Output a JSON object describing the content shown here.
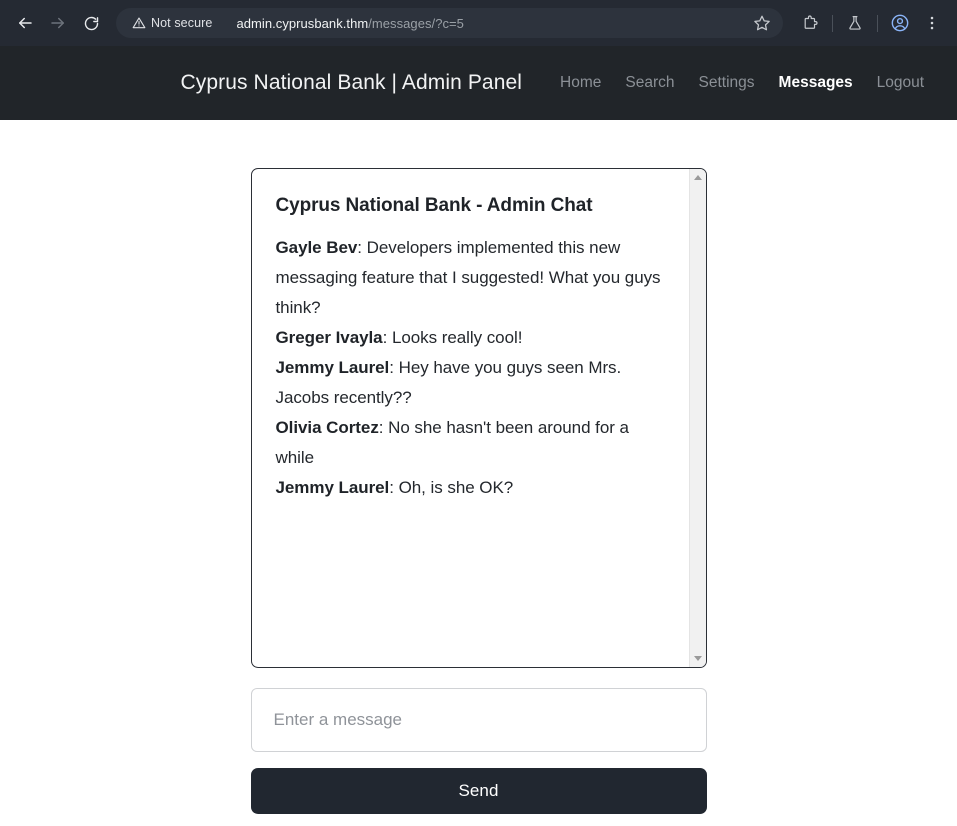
{
  "browser": {
    "back_icon": "arrow-left-icon",
    "forward_icon": "arrow-right-icon",
    "reload_icon": "reload-icon",
    "security_label": "Not secure",
    "security_icon": "warning-triangle-icon",
    "url_domain": "admin.cyprusbank.thm",
    "url_path": "/messages/?c=5",
    "bookmark_icon": "star-icon",
    "extensions_icon": "puzzle-piece-icon",
    "labs_icon": "flask-icon",
    "profile_icon": "account-circle-icon",
    "menu_icon": "three-dot-menu-icon",
    "colors": {
      "chrome_bg": "#252a33",
      "omnibox_bg": "#2d333d",
      "profile_accent": "#8ab4f8"
    }
  },
  "header": {
    "brand": "Cyprus National Bank | Admin Panel",
    "nav": [
      {
        "label": "Home",
        "active": false
      },
      {
        "label": "Search",
        "active": false
      },
      {
        "label": "Settings",
        "active": false
      },
      {
        "label": "Messages",
        "active": true
      },
      {
        "label": "Logout",
        "active": false
      }
    ],
    "bg_color": "#212529"
  },
  "chat": {
    "title": "Cyprus National Bank - Admin Chat",
    "messages": [
      {
        "sender": "Gayle Bev",
        "text": ": Developers implemented this new messaging feature that I suggested! What you guys think?"
      },
      {
        "sender": "Greger Ivayla",
        "text": ": Looks really cool!"
      },
      {
        "sender": "Jemmy Laurel",
        "text": ": Hey have you guys seen Mrs. Jacobs recently??"
      },
      {
        "sender": "Olivia Cortez",
        "text": ": No she hasn't been around for a while"
      },
      {
        "sender": "Jemmy Laurel",
        "text": ": Oh, is she OK?"
      }
    ],
    "scrollbar": {
      "up_icon": "scroll-up-arrow-icon",
      "down_icon": "scroll-down-arrow-icon"
    }
  },
  "compose": {
    "input_value": "",
    "input_placeholder": "Enter a message",
    "send_label": "Send",
    "send_bg": "#212730"
  }
}
